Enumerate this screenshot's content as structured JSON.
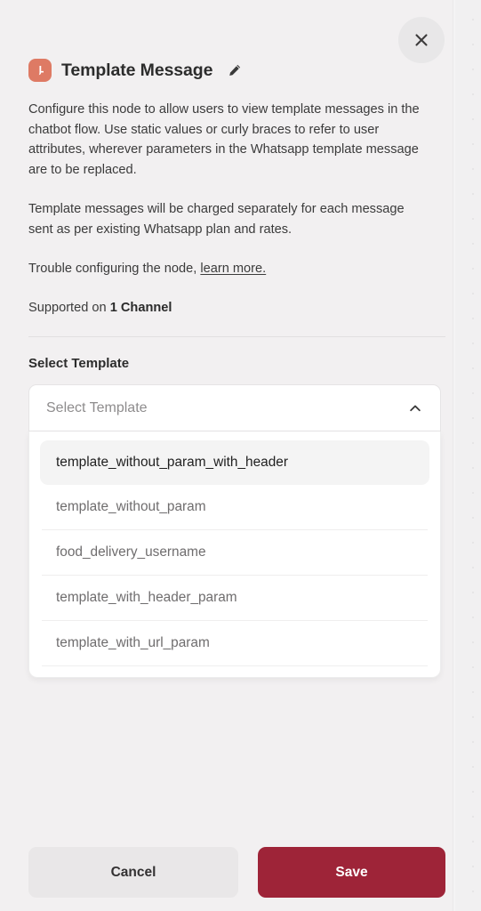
{
  "panel": {
    "close_label": "Close",
    "icon_name": "whatsapp-template-icon",
    "title": "Template Message",
    "edit_icon": "pencil-icon",
    "description_1": "Configure this node to allow users to view template messages in the chatbot flow. Use static values or curly braces to refer to user attributes, wherever parameters in the Whatsapp template message are to be replaced.",
    "description_2": "Template messages will be charged separately for each message sent as per existing Whatsapp plan and rates.",
    "trouble_text": "Trouble configuring the node, ",
    "trouble_link": "learn more.",
    "supported_prefix": "Supported on ",
    "supported_value": "1 Channel"
  },
  "select_template": {
    "label": "Select Template",
    "placeholder": "Select Template",
    "value": "",
    "expanded": true,
    "chevron_icon": "chevron-up-icon",
    "options": [
      {
        "label": "template_without_param_with_header",
        "selected": true
      },
      {
        "label": "template_without_param",
        "selected": false
      },
      {
        "label": "food_delivery_username",
        "selected": false
      },
      {
        "label": "template_with_header_param",
        "selected": false
      },
      {
        "label": "template_with_url_param",
        "selected": false
      }
    ]
  },
  "footer": {
    "cancel_label": "Cancel",
    "save_label": "Save"
  },
  "colors": {
    "panel_background": "#f2f0f1",
    "canvas_background": "#f4f3f4",
    "node_icon": "#de7a64",
    "save_button": "#9e2438",
    "cancel_button": "#e9e7e8",
    "text_primary": "#2c2c2c",
    "text_secondary": "#6f6d6e",
    "placeholder": "#8e8c8d"
  }
}
